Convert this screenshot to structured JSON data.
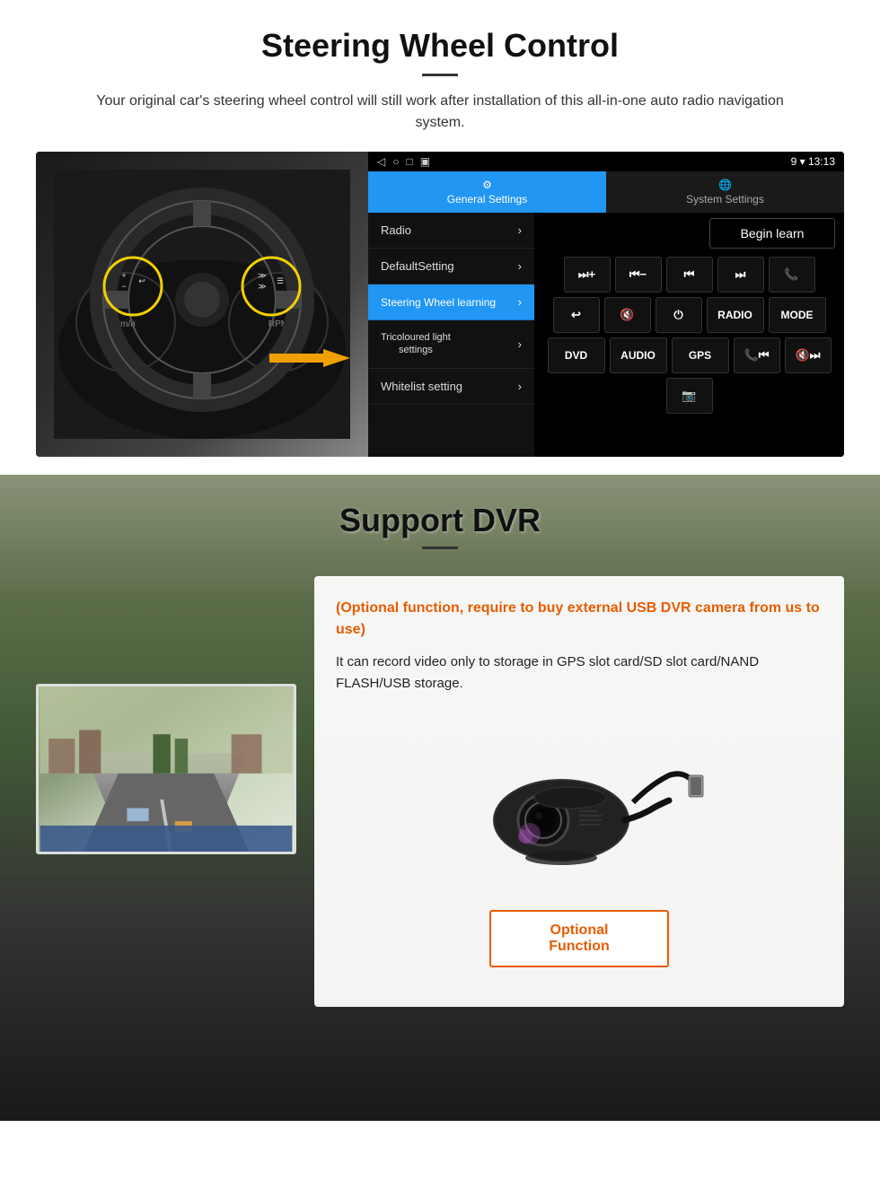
{
  "steering": {
    "title": "Steering Wheel Control",
    "description": "Your original car's steering wheel control will still work after installation of this all-in-one auto radio navigation system.",
    "statusbar": {
      "left_icons": [
        "◁",
        "○",
        "□",
        "▣"
      ],
      "right": "9 ▾ 13:13"
    },
    "tabs": {
      "active": "General Settings",
      "inactive": "System Settings"
    },
    "menu_items": [
      {
        "label": "Radio",
        "active": false
      },
      {
        "label": "DefaultSetting",
        "active": false
      },
      {
        "label": "Steering Wheel learning",
        "active": true
      },
      {
        "label": "Tricoloured light settings",
        "active": false
      },
      {
        "label": "Whitelist setting",
        "active": false
      }
    ],
    "begin_learn_label": "Begin learn",
    "control_buttons_row1": [
      "⏮+",
      "⏮−",
      "⏮",
      "⏭",
      "📞"
    ],
    "control_buttons_row2": [
      "↩",
      "🔇",
      "⏻",
      "RADIO",
      "MODE"
    ],
    "control_buttons_row3": [
      "DVD",
      "AUDIO",
      "GPS",
      "📞⏮",
      "🔇⏭"
    ],
    "control_buttons_row4": [
      "📷"
    ]
  },
  "dvr": {
    "title": "Support DVR",
    "optional_text": "(Optional function, require to buy external USB DVR camera from us to use)",
    "description": "It can record video only to storage in GPS slot card/SD slot card/NAND FLASH/USB storage.",
    "optional_function_label": "Optional Function"
  }
}
